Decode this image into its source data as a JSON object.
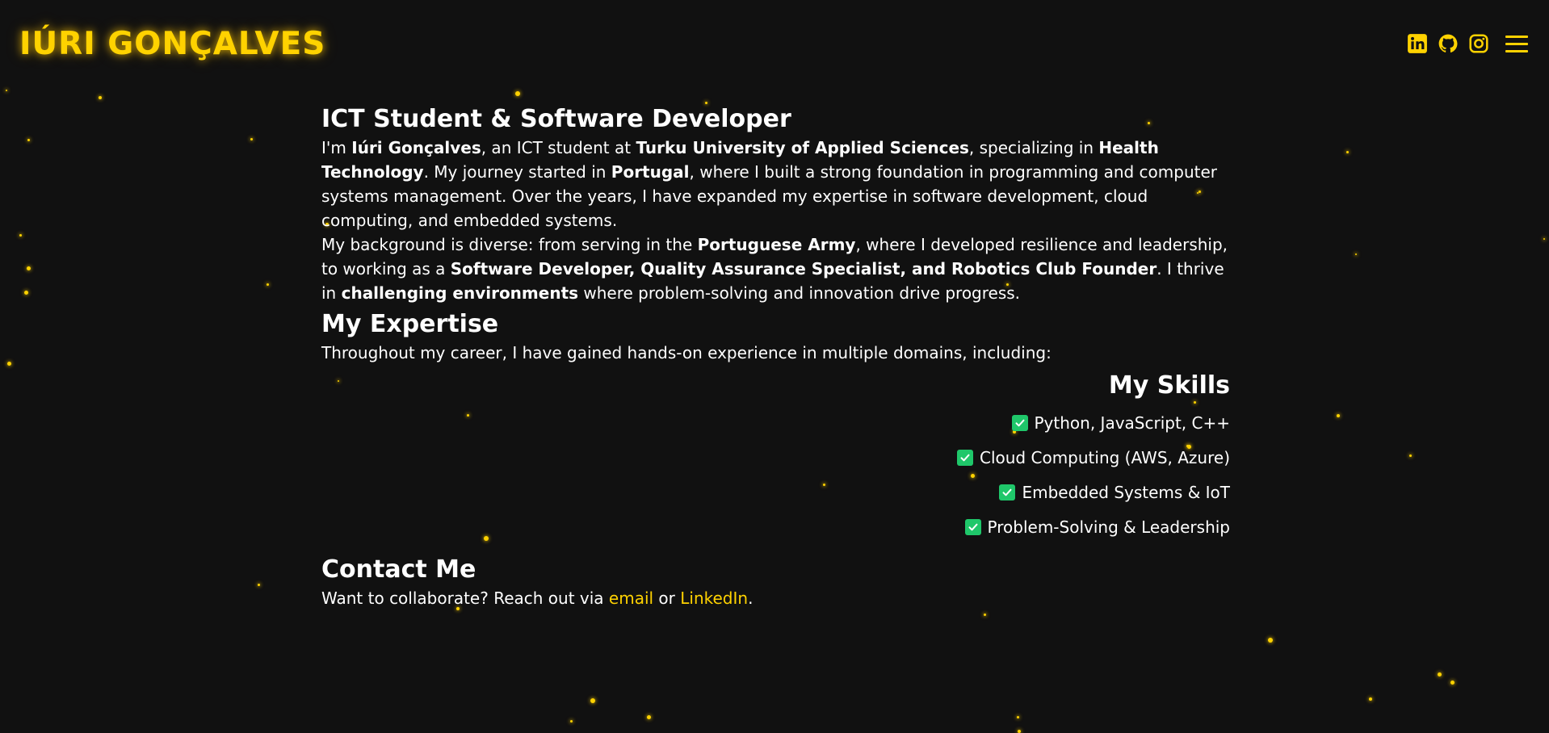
{
  "header": {
    "logo_text": "IÚRI GONÇALVES",
    "icons": [
      "linkedin-icon",
      "github-icon",
      "instagram-icon",
      "menu-icon"
    ]
  },
  "colors": {
    "background": "#111111",
    "accent": "#ffd200",
    "text": "#ffffff",
    "check": "#1fc76a"
  },
  "about": {
    "title": "ICT Student & Software Developer",
    "p1": {
      "t1": "I'm ",
      "b1": "Iúri Gonçalves",
      "t2": ", an ICT student at ",
      "b2": "Turku University of Applied Sciences",
      "t3": ", specializing in ",
      "b3": "Health Technology",
      "t4": ". My journey started in ",
      "b4": "Portugal",
      "t5": ", where I built a strong foundation in programming and computer systems management. Over the years, I have expanded my expertise in software development, cloud computing, and embedded systems."
    },
    "p2": {
      "t1": "My background is diverse: from serving in the ",
      "b1": "Portuguese Army",
      "t2": ", where I developed resilience and leadership, to working as a ",
      "b2": "Software Developer, Quality Assurance Specialist, and Robotics Club Founder",
      "t3": ". I thrive in ",
      "b3": "challenging environments",
      "t4": " where problem-solving and innovation drive progress."
    }
  },
  "expertise": {
    "title": "My Expertise",
    "text": "Throughout my career, I have gained hands-on experience in multiple domains, including:"
  },
  "skills": {
    "title": "My Skills",
    "items": [
      "Python, JavaScript, C++",
      "Cloud Computing (AWS, Azure)",
      "Embedded Systems & IoT",
      "Problem-Solving & Leadership"
    ]
  },
  "contact": {
    "title": "Contact Me",
    "text_before": "Want to collaborate? Reach out via ",
    "email_link": "email",
    "text_middle": " or ",
    "linkedin_link": "LinkedIn",
    "text_after": "."
  }
}
